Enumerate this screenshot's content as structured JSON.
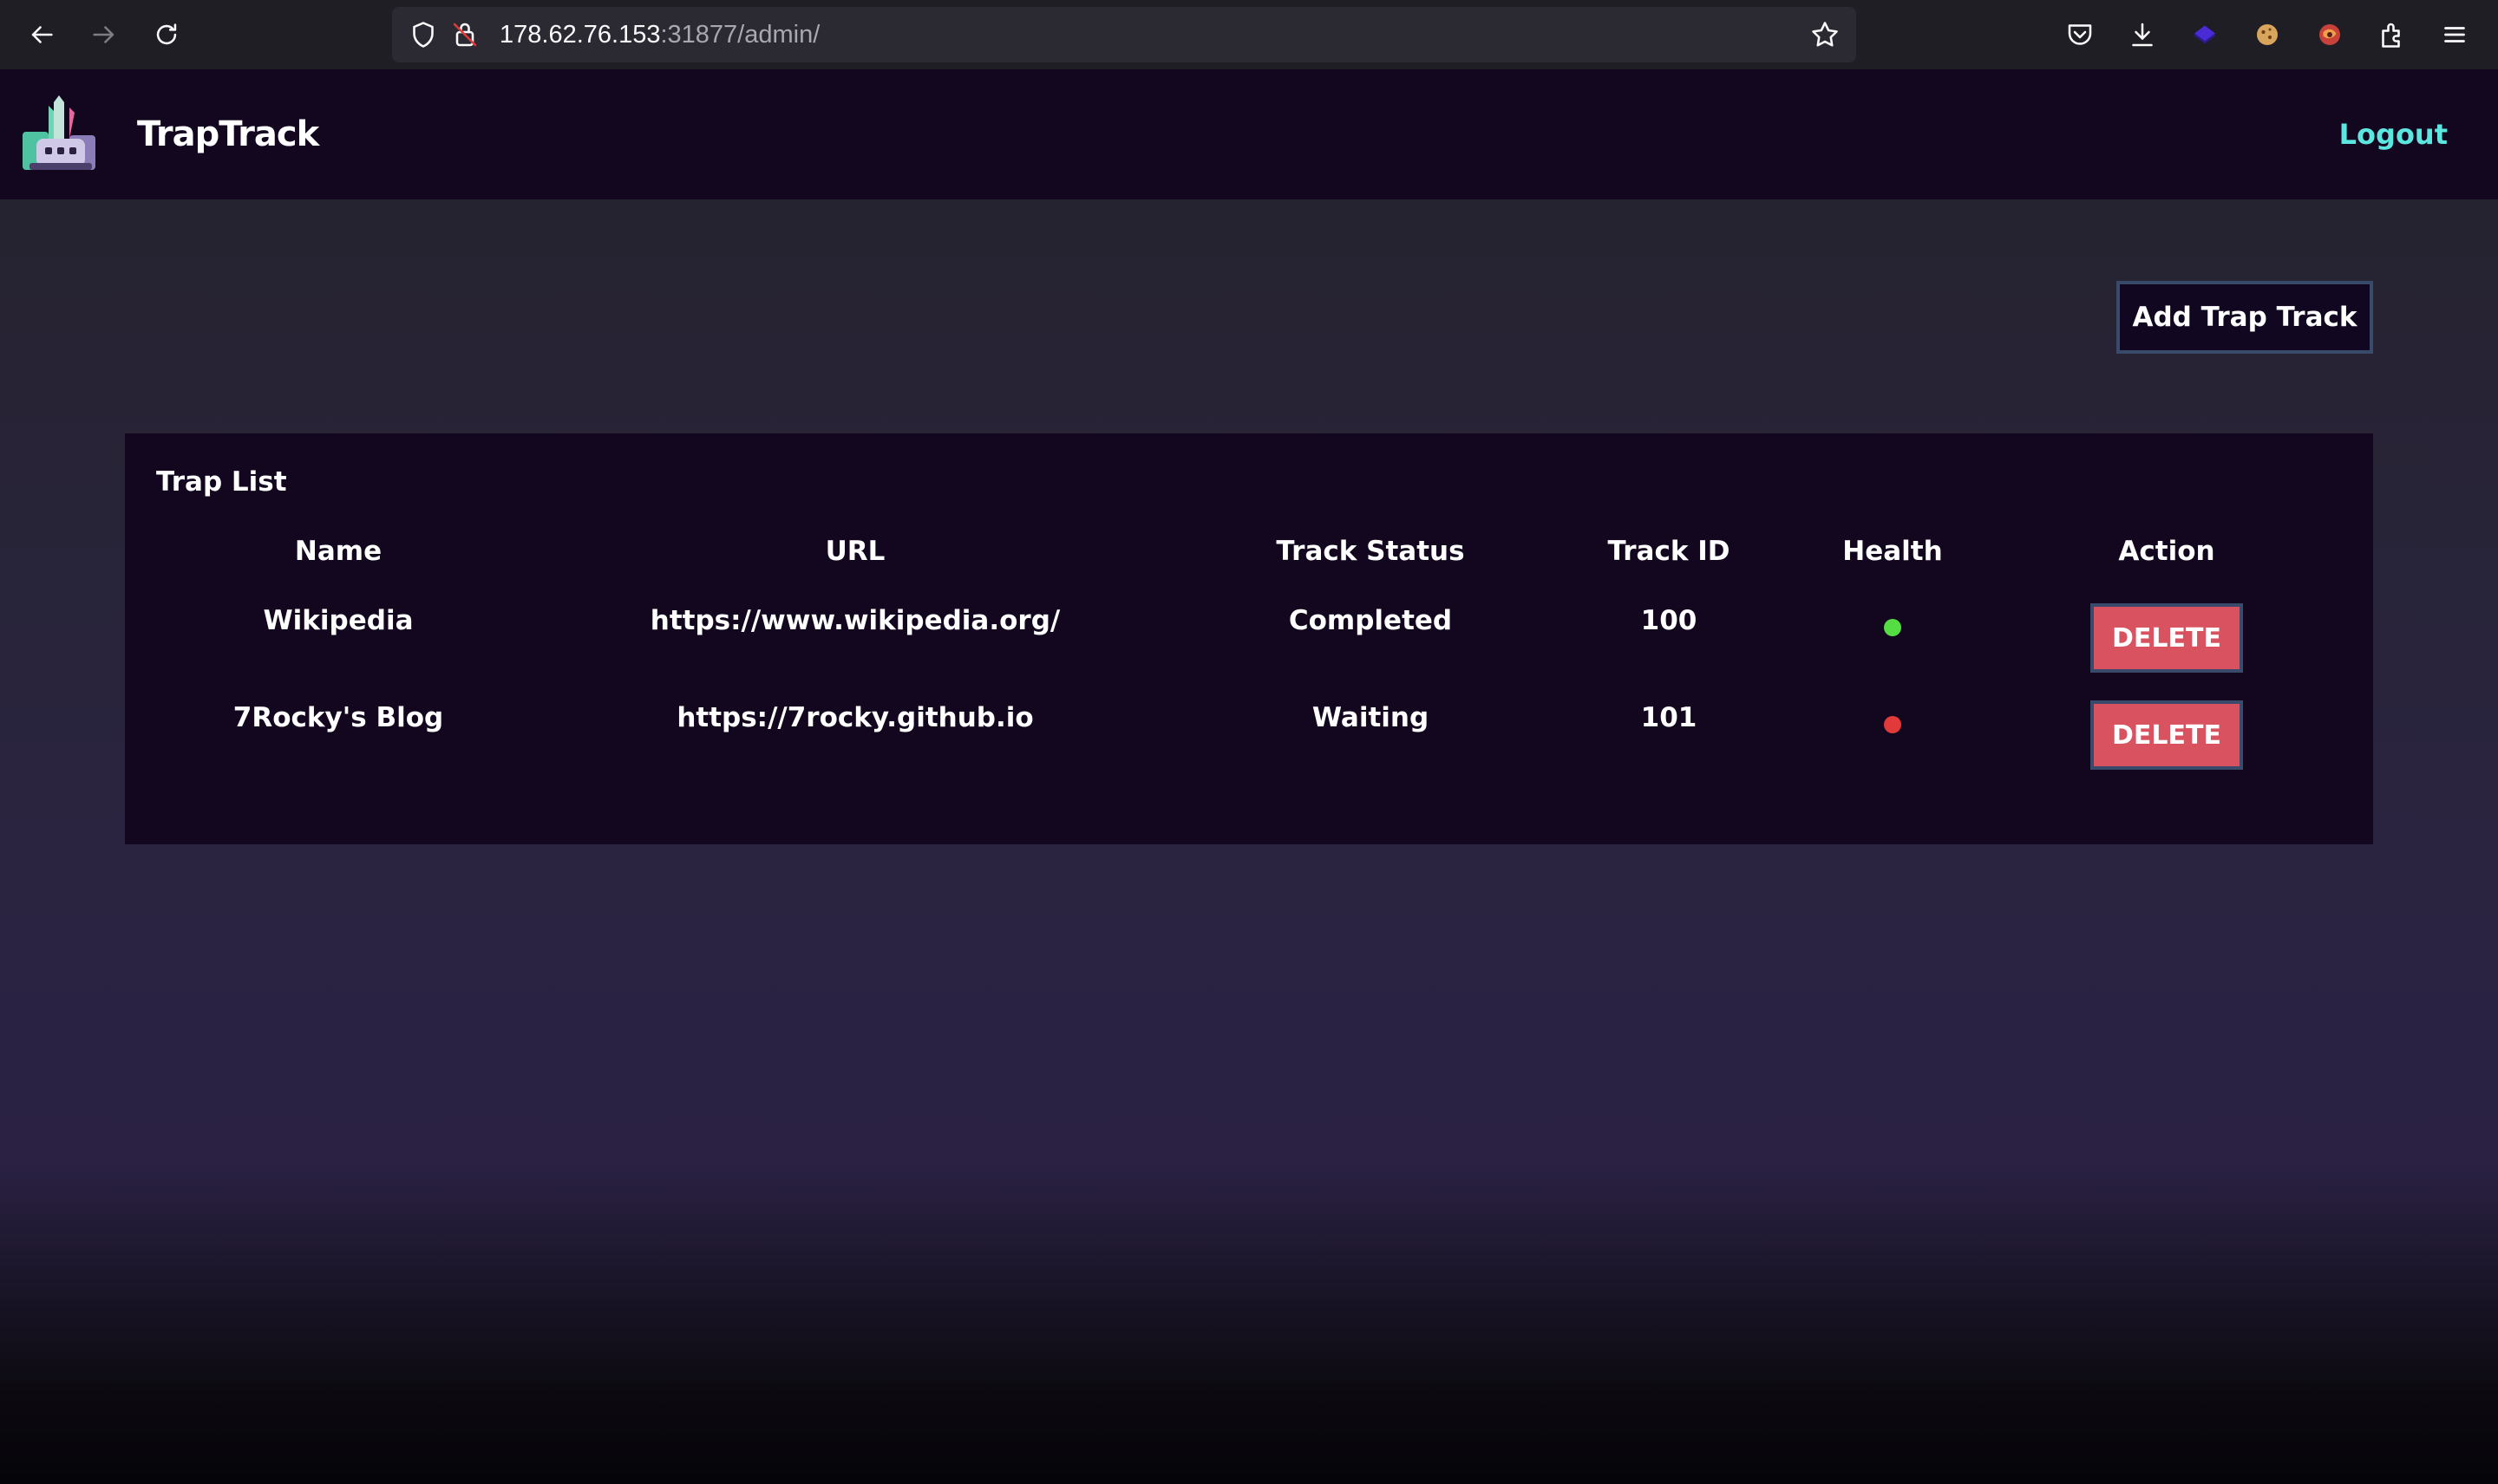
{
  "browser": {
    "url_host": "178.62.76.153",
    "url_rest": ":31877/admin/"
  },
  "header": {
    "brand": "TrapTrack",
    "logout_label": "Logout"
  },
  "main": {
    "add_button_label": "Add Trap Track",
    "panel_title": "Trap List",
    "columns": [
      "Name",
      "URL",
      "Track Status",
      "Track ID",
      "Health",
      "Action"
    ],
    "rows": [
      {
        "name": "Wikipedia",
        "url": "https://www.wikipedia.org/",
        "status": "Completed",
        "track_id": "100",
        "health": "healthy",
        "health_color": "#55dd44",
        "action_label": "DELETE"
      },
      {
        "name": "7Rocky's Blog",
        "url": "https://7rocky.github.io",
        "status": "Waiting",
        "track_id": "101",
        "health": "unhealthy",
        "health_color": "#e23a3a",
        "action_label": "DELETE"
      }
    ]
  },
  "colors": {
    "accent_link": "#5ce6e0",
    "delete_button": "#d9525f",
    "header_bg": "#13061f"
  }
}
